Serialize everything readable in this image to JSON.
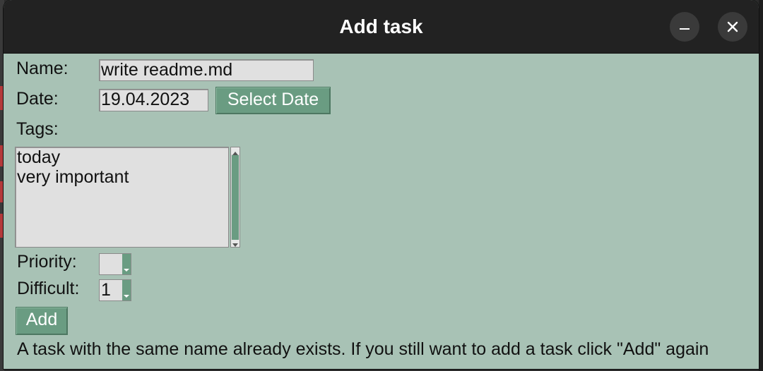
{
  "window": {
    "title": "Add task"
  },
  "titlebar_buttons": {
    "minimize_icon": "minimize-icon",
    "close_icon": "close-icon"
  },
  "form": {
    "name_label": "Name:",
    "name_value": "write readme.md",
    "date_label": "Date:",
    "date_value": "19.04.2023",
    "select_date_label": "Select Date",
    "tags_label": "Tags:",
    "tags_lines": [
      "today",
      "very important"
    ],
    "priority_label": "Priority:",
    "priority_value": "",
    "difficult_label": "Difficult:",
    "difficult_value": "1",
    "add_label": "Add"
  },
  "status": {
    "message": "A task with the same name already exists. If you still want to add a task click \"Add\" again"
  },
  "colors": {
    "window_bg": "#a8c2b5",
    "titlebar_bg": "#222222",
    "button_bg": "#6a9c82",
    "field_bg": "#e0e0e0"
  }
}
